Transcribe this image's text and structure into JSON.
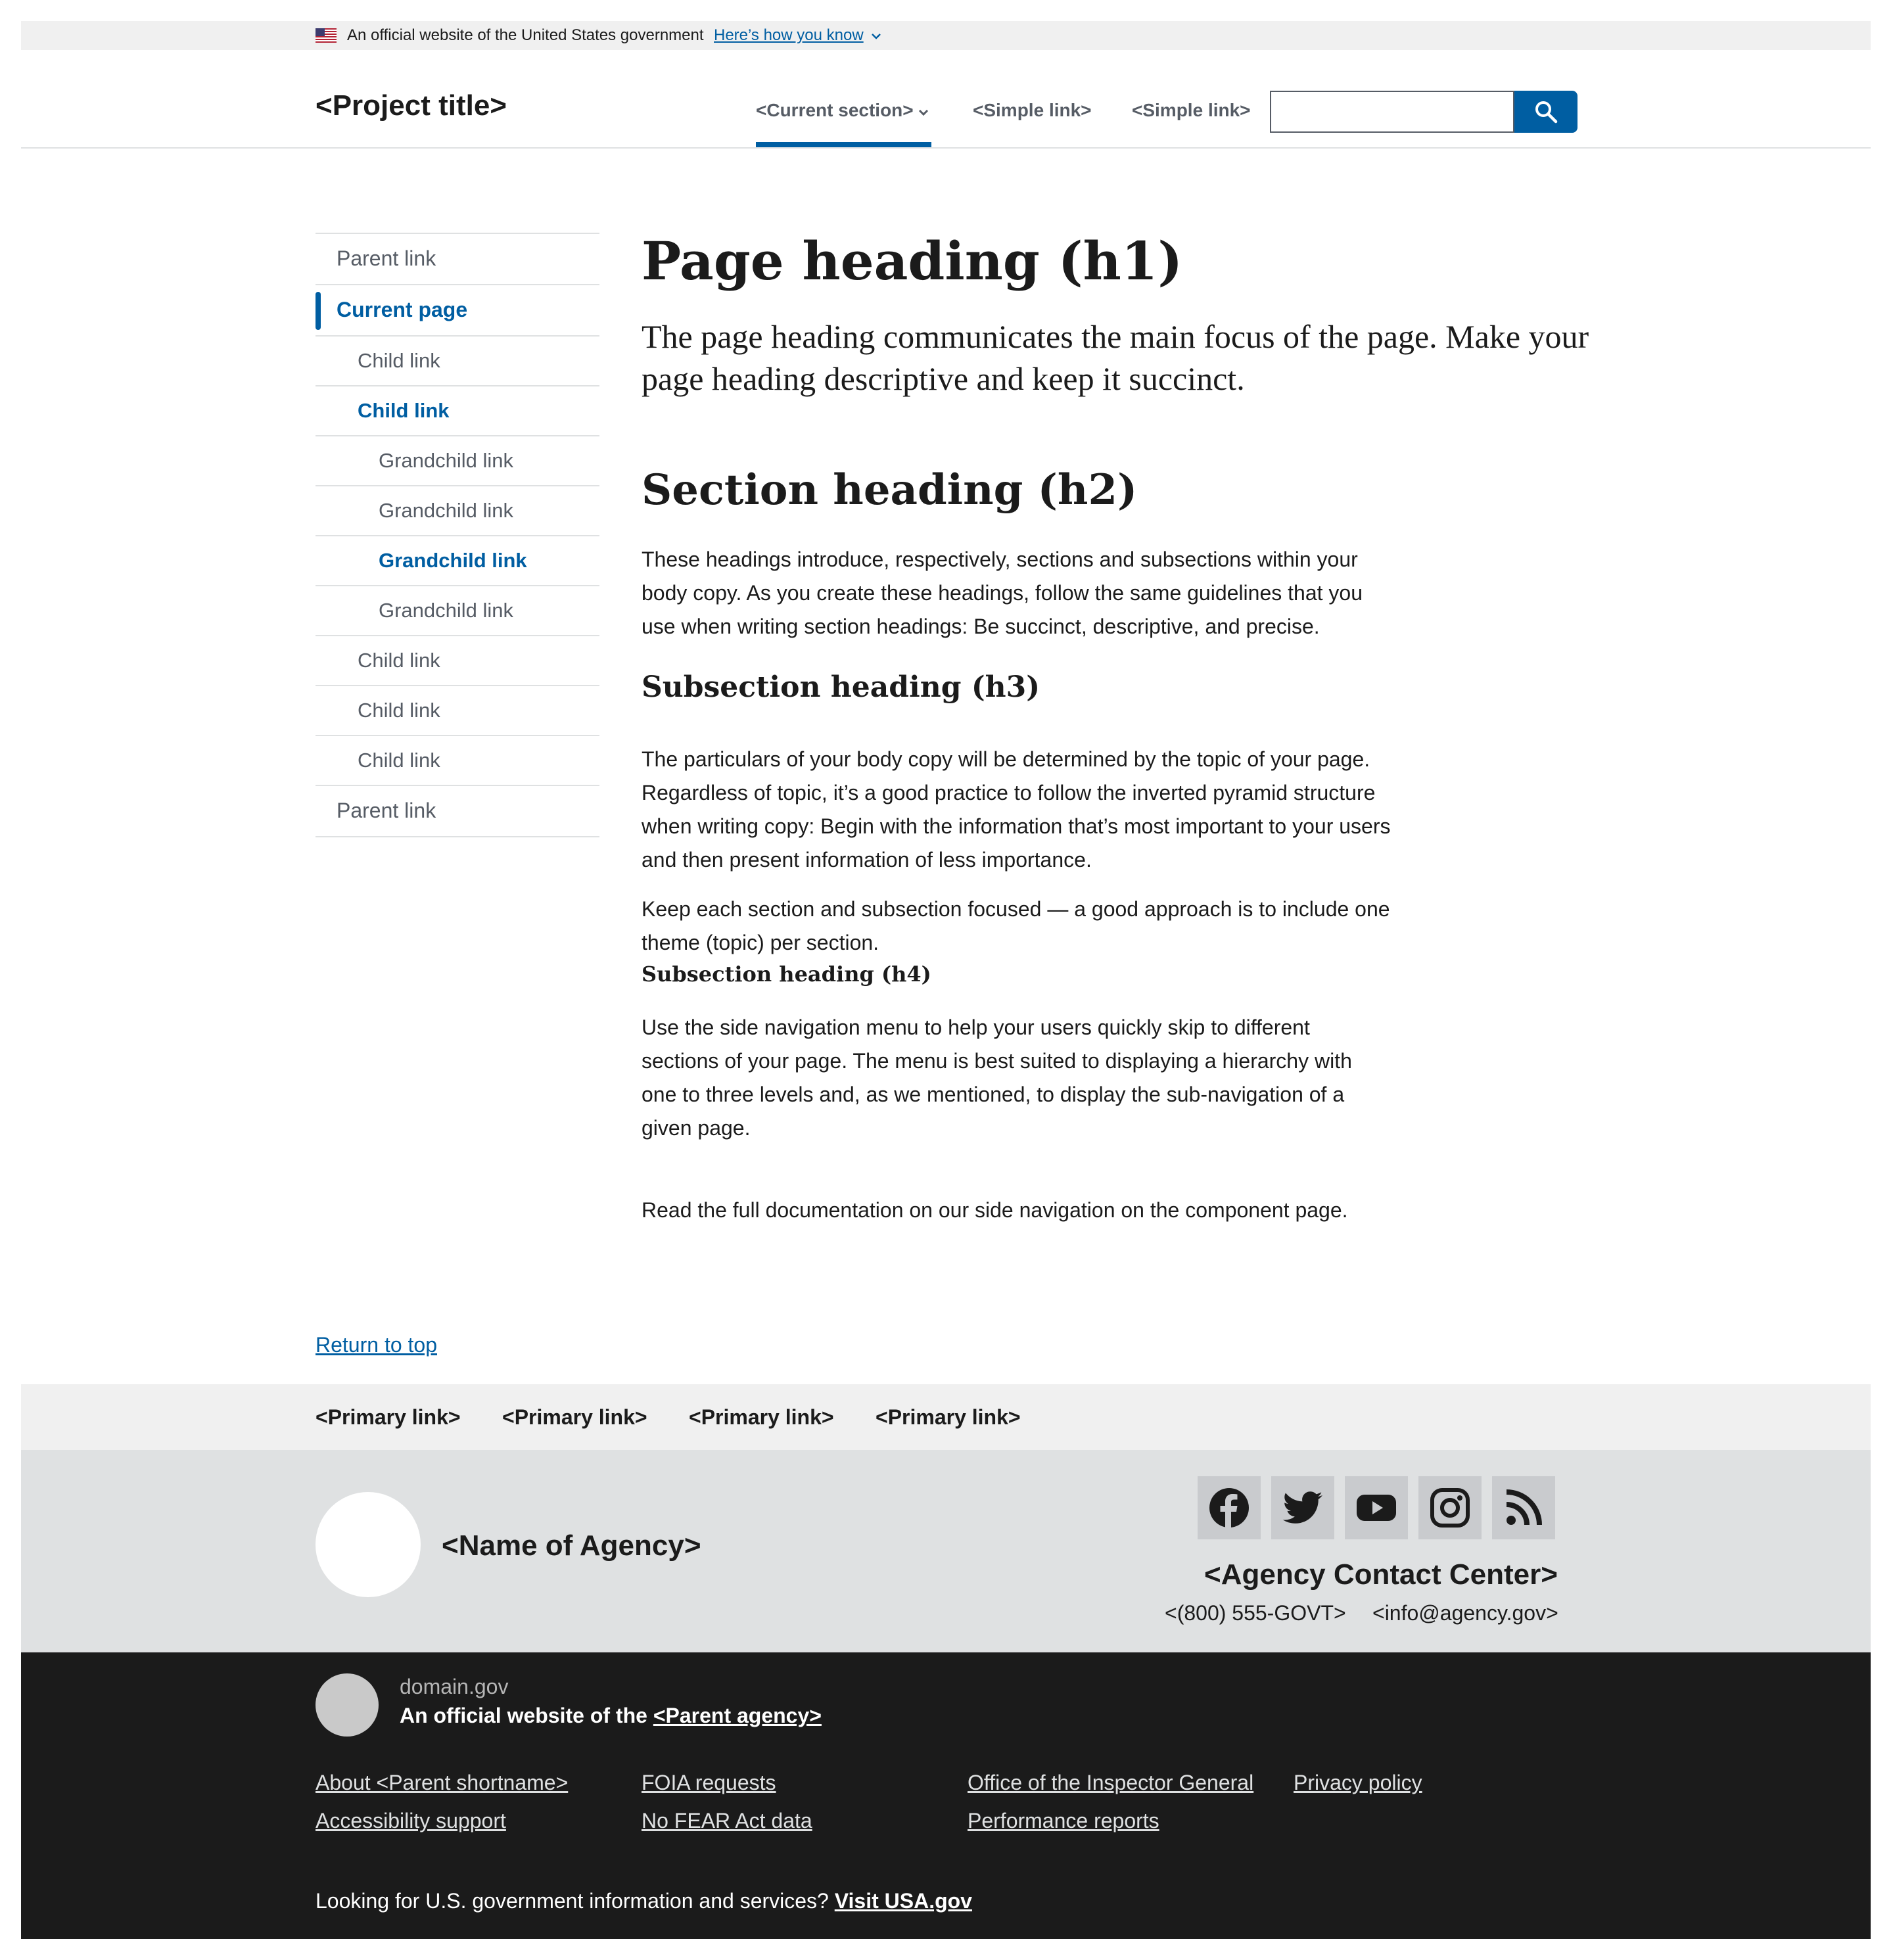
{
  "banner": {
    "official_text": "An official website of the United States government",
    "how_you_know": "Here’s how you know"
  },
  "header": {
    "project_title": "<Project title>",
    "nav": {
      "current_section": "<Current section>",
      "simple_link_1": "<Simple link>",
      "simple_link_2": "<Simple link>"
    },
    "search": {
      "value": "",
      "button_icon": "search-icon"
    }
  },
  "sidenav": {
    "items": [
      {
        "label": "Parent link",
        "level": 0,
        "state": "normal"
      },
      {
        "label": "Current page",
        "level": 0,
        "state": "current"
      },
      {
        "label": "Child link",
        "level": 1,
        "state": "normal"
      },
      {
        "label": "Child link",
        "level": 1,
        "state": "active"
      },
      {
        "label": "Grandchild link",
        "level": 2,
        "state": "normal"
      },
      {
        "label": "Grandchild link",
        "level": 2,
        "state": "normal"
      },
      {
        "label": "Grandchild link",
        "level": 2,
        "state": "active"
      },
      {
        "label": "Grandchild link",
        "level": 2,
        "state": "normal"
      },
      {
        "label": "Child link",
        "level": 1,
        "state": "normal"
      },
      {
        "label": "Child link",
        "level": 1,
        "state": "normal"
      },
      {
        "label": "Child link",
        "level": 1,
        "state": "normal"
      },
      {
        "label": "Parent link",
        "level": 0,
        "state": "normal"
      }
    ]
  },
  "main": {
    "h1": "Page heading (h1)",
    "lead": "The page heading communicates the main focus of the page. Make your page heading descriptive and keep it succinct.",
    "h2": "Section heading (h2)",
    "p1": "These headings introduce, respectively, sections and subsections within your body copy. As you create these headings, follow the same guidelines that you use when writing section headings: Be succinct, descriptive, and precise.",
    "h3": "Subsection heading (h3)",
    "p2": "The particulars of your body copy will be determined by the topic of your page. Regardless of topic, it’s a good practice to follow the inverted pyramid structure when writing copy: Begin with the information that’s most important to your users and then present information of less importance.",
    "p3": "Keep each section and subsection focused — a good approach is to include one theme (topic) per section.",
    "h4": "Subsection heading (h4)",
    "p4": "Use the side navigation menu to help your users quickly skip to different sections of your page. The menu is best suited to displaying a hierarchy with one to three levels and, as we mentioned, to display the sub-navigation of a given page.",
    "p5": "Read the full documentation on our side navigation on the component page."
  },
  "return_to_top": "Return to top",
  "footer": {
    "primary_links": [
      "<Primary link>",
      "<Primary link>",
      "<Primary link>",
      "<Primary link>"
    ],
    "agency_name": "<Name of Agency>",
    "social_icons": [
      "facebook-icon",
      "twitter-icon",
      "youtube-icon",
      "instagram-icon",
      "rss-icon"
    ],
    "contact_center": "<Agency Contact Center>",
    "phone": "<(800) 555-GOVT>",
    "email": "<info@agency.gov>"
  },
  "identifier": {
    "domain": "domain.gov",
    "official_prefix": "An official website of the ",
    "parent_agency": "<Parent agency>",
    "links": [
      "About <Parent shortname>",
      "FOIA requests",
      "Office of the Inspector General",
      "Privacy policy",
      "Accessibility support",
      "No FEAR Act data",
      "Performance reports"
    ],
    "usa_prefix": "Looking for U.S. government information and services? ",
    "usa_link": "Visit USA.gov"
  },
  "colors": {
    "primary": "#005ea2",
    "banner_bg": "#f0f0f0",
    "footer_secondary_bg": "#dfe1e2",
    "identifier_bg": "#1b1b1b"
  }
}
